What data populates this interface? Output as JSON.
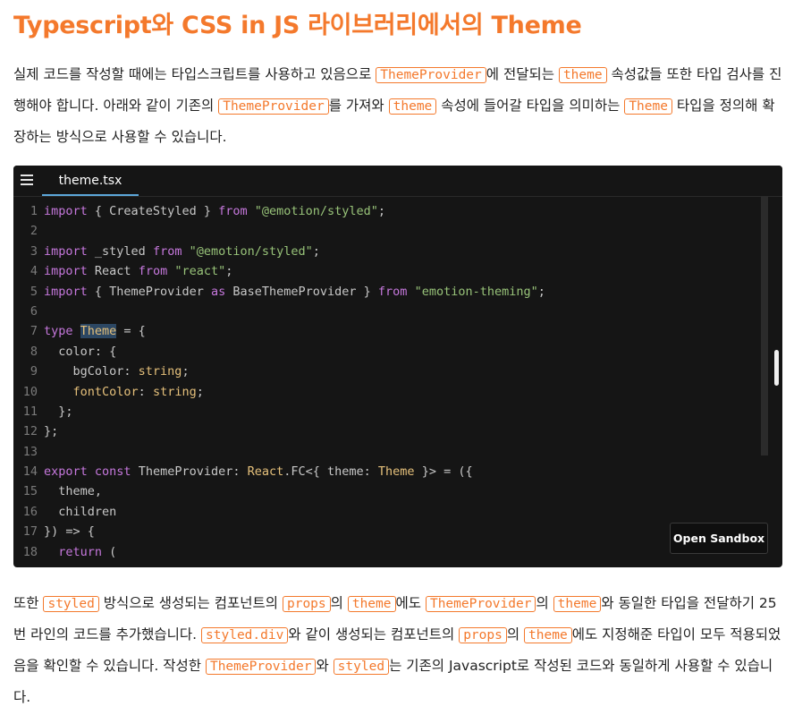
{
  "title": "Typescript와 CSS in JS 라이브러리에서의 Theme",
  "para1": {
    "t1": "실제 코드를 작성할 때에는 타입스크립트를 사용하고 있음으로",
    "c1": "ThemeProvider",
    "t2": "에 전달되는",
    "c2": "theme",
    "t3": "속성값들 또한 타입 검사를 진행해야 합니다. 아래와 같이 기존의",
    "c3": "ThemeProvider",
    "t4": "를 가져와",
    "c4": "theme",
    "t5": "속성에 들어갈 타입을 의미하는",
    "c5": "Theme",
    "t6": "타입을 정의해 확장하는 방식으로 사용할 수 있습니다."
  },
  "editor": {
    "tab_label": "theme.tsx",
    "open_sandbox_label": "Open Sandbox",
    "lines": {
      "l1": {
        "n": "1",
        "a": "import",
        "b": " { CreateStyled } ",
        "c": "from",
        "d": " ",
        "e": "\"@emotion/styled\"",
        "f": ";"
      },
      "l2": {
        "n": "2"
      },
      "l3": {
        "n": "3",
        "a": "import",
        "b": " _styled ",
        "c": "from",
        "d": " ",
        "e": "\"@emotion/styled\"",
        "f": ";"
      },
      "l4": {
        "n": "4",
        "a": "import",
        "b": " React ",
        "c": "from",
        "d": " ",
        "e": "\"react\"",
        "f": ";"
      },
      "l5": {
        "n": "5",
        "a": "import",
        "b": " { ThemeProvider ",
        "c": "as",
        "d": " BaseThemeProvider } ",
        "e": "from",
        "f": " ",
        "g": "\"emotion-theming\"",
        "h": ";"
      },
      "l6": {
        "n": "6"
      },
      "l7": {
        "n": "7",
        "a": "type",
        "b": " ",
        "c": "Theme",
        "d": " = {"
      },
      "l8": {
        "n": "8",
        "a": "  color: {"
      },
      "l9": {
        "n": "9",
        "a": "    bgColor: ",
        "b": "string",
        "c": ";"
      },
      "l10": {
        "n": "10",
        "a": "    fontColor",
        "b": ": ",
        "c": "string",
        "d": ";"
      },
      "l11": {
        "n": "11",
        "a": "  };"
      },
      "l12": {
        "n": "12",
        "a": "};"
      },
      "l13": {
        "n": "13"
      },
      "l14": {
        "n": "14",
        "a": "export",
        "b": " ",
        "c": "const",
        "d": " ThemeProvider: ",
        "e": "React",
        "f": ".FC<{ theme: ",
        "g": "Theme",
        "h": " }> = ({"
      },
      "l15": {
        "n": "15",
        "a": "  theme,"
      },
      "l16": {
        "n": "16",
        "a": "  children"
      },
      "l17": {
        "n": "17",
        "a": "}) => {"
      },
      "l18": {
        "n": "18",
        "a": "  return",
        "b": " ("
      }
    }
  },
  "para2": {
    "t1": "또한",
    "c1": "styled",
    "t2": "방식으로 생성되는 컴포넌트의",
    "c2": "props",
    "t3": "의",
    "c3": "theme",
    "t4": "에도",
    "c4": "ThemeProvider",
    "t5": "의",
    "c5": "theme",
    "t6": "와 동일한 타입을 전달하기 25번 라인의 코드를 추가했습니다.",
    "c6": "styled.div",
    "t7": "와 같이 생성되는 컴포넌트의",
    "c7": "props",
    "t8": "의",
    "c8": "theme",
    "t9": "에도 지정해준 타입이 모두 적용되었음을 확인할 수 있습니다. 작성한",
    "c9": "ThemeProvider",
    "t10": "와",
    "c10": "styled",
    "t11": "는 기존의 Javascript로 작성된 코드와 동일하게 사용할 수 있습니다."
  }
}
